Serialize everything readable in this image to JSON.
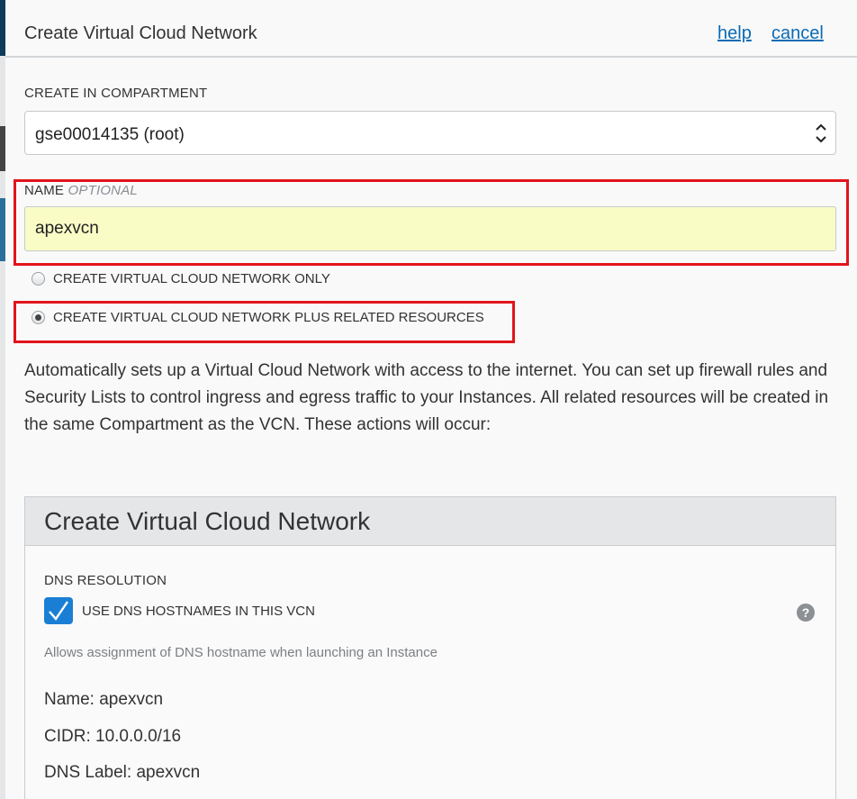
{
  "dialog": {
    "title": "Create Virtual Cloud Network",
    "help_link": "help",
    "cancel_link": "cancel"
  },
  "compartment": {
    "label": "CREATE IN COMPARTMENT",
    "selected": "gse00014135 (root)"
  },
  "name_field": {
    "label": "NAME",
    "optional_tag": "OPTIONAL",
    "value": "apexvcn"
  },
  "radio_options": [
    {
      "label": "CREATE VIRTUAL CLOUD NETWORK ONLY",
      "checked": false
    },
    {
      "label": "CREATE VIRTUAL CLOUD NETWORK PLUS RELATED RESOURCES",
      "checked": true
    }
  ],
  "description": "Automatically sets up a Virtual Cloud Network with access to the internet. You can set up firewall rules and Security Lists to control ingress and egress traffic to your Instances. All related resources will be created in the same Compartment as the VCN. These actions will occur:",
  "panel": {
    "title": "Create Virtual Cloud Network",
    "dns_label": "DNS RESOLUTION",
    "checkbox_label": "USE DNS HOSTNAMES IN THIS VCN",
    "checkbox_checked": true,
    "hint": "Allows assignment of DNS hostname when launching an Instance",
    "help_icon": "?",
    "info": [
      "Name: apexvcn",
      "CIDR: 10.0.0.0/16",
      "DNS Label: apexvcn"
    ]
  },
  "colors": {
    "link": "#0b6bb5",
    "highlight_border": "#e2141b",
    "input_autofill": "#fafcc6",
    "checkbox": "#1a7fd4"
  }
}
